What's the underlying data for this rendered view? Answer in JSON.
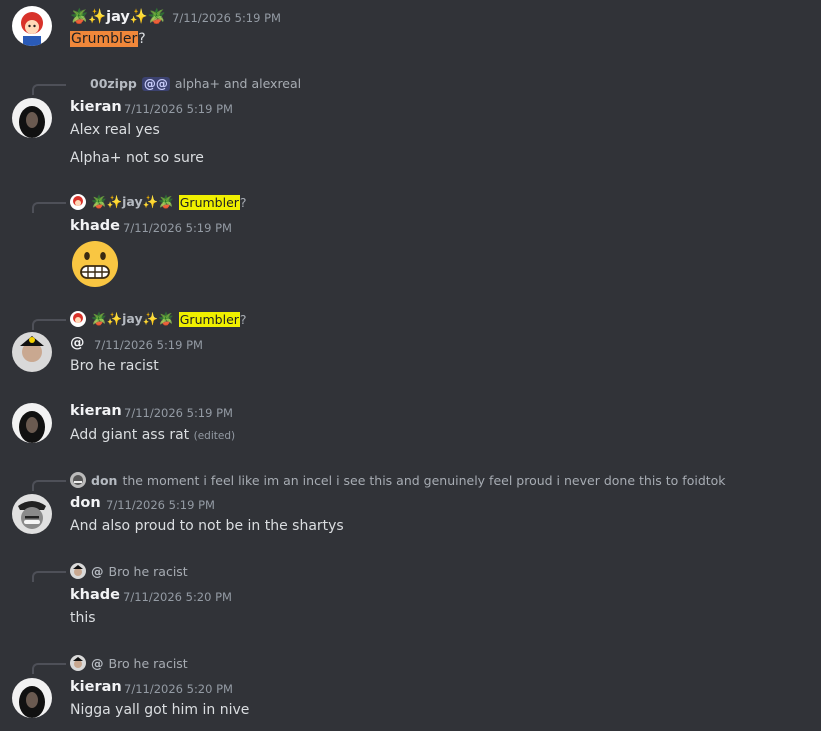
{
  "messages": [
    {
      "username": "🪴✨jay✨🪴",
      "timestamp": "7/11/2026 5:19 PM",
      "text_highlight": "Grumbler",
      "text_tail": "?"
    },
    {
      "reply": {
        "name": "00zipp",
        "badge": "@@",
        "text": "alpha+ and alexreal"
      },
      "username": "kieran",
      "timestamp": "7/11/2026 5:19 PM",
      "lines": [
        "Alex real yes",
        "Alpha+ not so sure"
      ]
    },
    {
      "reply": {
        "name": "🪴✨jay✨🪴",
        "highlight": "Grumbler",
        "tail": "?"
      },
      "username": "khade",
      "timestamp": "7/11/2026 5:19 PM",
      "emoji": "grimacing-face"
    },
    {
      "reply": {
        "name": "🪴✨jay✨🪴",
        "highlight": "Grumbler",
        "tail": "?"
      },
      "username": "@",
      "timestamp": "7/11/2026 5:19 PM",
      "text": "Bro he racist"
    },
    {
      "username": "kieran",
      "timestamp": "7/11/2026 5:19 PM",
      "text": "Add giant ass rat",
      "edited": "(edited)"
    },
    {
      "reply": {
        "name": "don",
        "text": "the moment i feel like im an incel i see this and genuinely feel proud i never done this to foidtok"
      },
      "username": "don",
      "timestamp": "7/11/2026 5:19 PM",
      "text": "And also proud to not be in the shartys"
    },
    {
      "reply": {
        "name": "@",
        "text": "Bro he racist"
      },
      "username": "khade",
      "timestamp": "7/11/2026 5:20 PM",
      "text": "this"
    },
    {
      "reply": {
        "name": "@",
        "text": "Bro he racist"
      },
      "username": "kieran",
      "timestamp": "7/11/2026 5:20 PM",
      "text": "Nigga yall got him in nive"
    }
  ]
}
